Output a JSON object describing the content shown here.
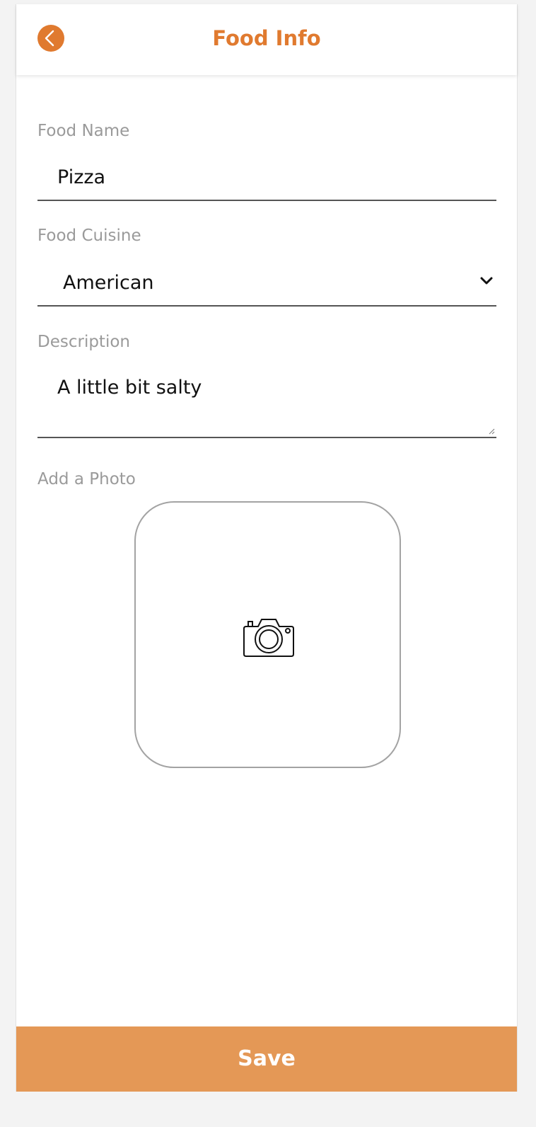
{
  "header": {
    "title": "Food Info",
    "back_icon": "chevron-left-icon",
    "accent_color": "#e07a2f"
  },
  "form": {
    "food_name": {
      "label": "Food Name",
      "value": "Pizza"
    },
    "food_cuisine": {
      "label": "Food Cuisine",
      "selected": "American",
      "icon": "chevron-down-icon"
    },
    "description": {
      "label": "Description",
      "value": "A little bit salty"
    },
    "photo": {
      "label": "Add a Photo",
      "icon": "camera-icon"
    }
  },
  "footer": {
    "save_label": "Save",
    "button_color": "#e49856"
  }
}
